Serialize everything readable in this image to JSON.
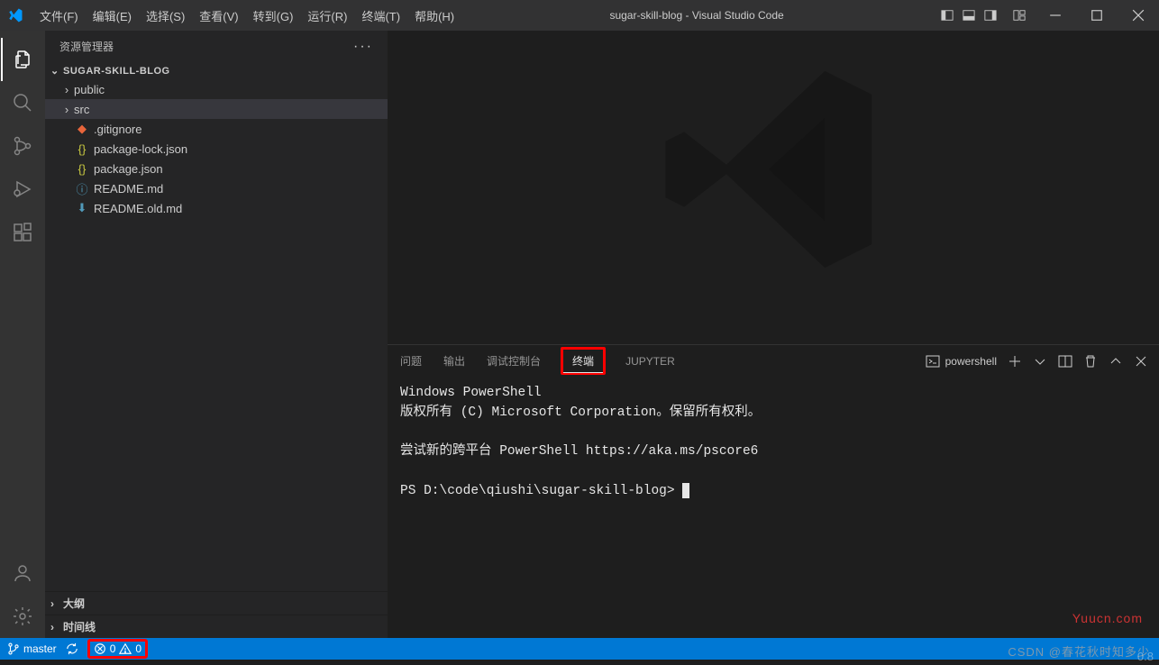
{
  "titlebar": {
    "menus": [
      "文件(F)",
      "编辑(E)",
      "选择(S)",
      "查看(V)",
      "转到(G)",
      "运行(R)",
      "终端(T)",
      "帮助(H)"
    ],
    "title": "sugar-skill-blog - Visual Studio Code"
  },
  "sidebar": {
    "header": "资源管理器",
    "folder": "SUGAR-SKILL-BLOG",
    "tree": [
      {
        "type": "folder",
        "label": "public",
        "selected": false
      },
      {
        "type": "folder",
        "label": "src",
        "selected": true
      },
      {
        "type": "file",
        "label": ".gitignore",
        "icon": "git",
        "color": "#8b8b8b"
      },
      {
        "type": "file",
        "label": "package-lock.json",
        "icon": "json",
        "color": "#cbcb41"
      },
      {
        "type": "file",
        "label": "package.json",
        "icon": "json",
        "color": "#cbcb41"
      },
      {
        "type": "file",
        "label": "README.md",
        "icon": "info",
        "color": "#519aba"
      },
      {
        "type": "file",
        "label": "README.old.md",
        "icon": "arrow",
        "color": "#519aba"
      }
    ],
    "outline": "大纲",
    "timeline": "时间线"
  },
  "panel": {
    "tabs": [
      "问题",
      "输出",
      "调试控制台",
      "终端",
      "JUPYTER"
    ],
    "active_tab": "终端",
    "shell": "powershell"
  },
  "terminal": {
    "line1": "Windows PowerShell",
    "line2": "版权所有 (C) Microsoft Corporation。保留所有权利。",
    "line3": "",
    "line4": "尝试新的跨平台 PowerShell https://aka.ms/pscore6",
    "line5": "",
    "prompt": "PS D:\\code\\qiushi\\sugar-skill-blog> "
  },
  "statusbar": {
    "branch": "master",
    "errors": "0",
    "warnings": "0"
  },
  "watermarks": {
    "w1": "Yuucn.com",
    "w2": "CSDN @春花秋时知多少",
    "w3": "0.8"
  }
}
